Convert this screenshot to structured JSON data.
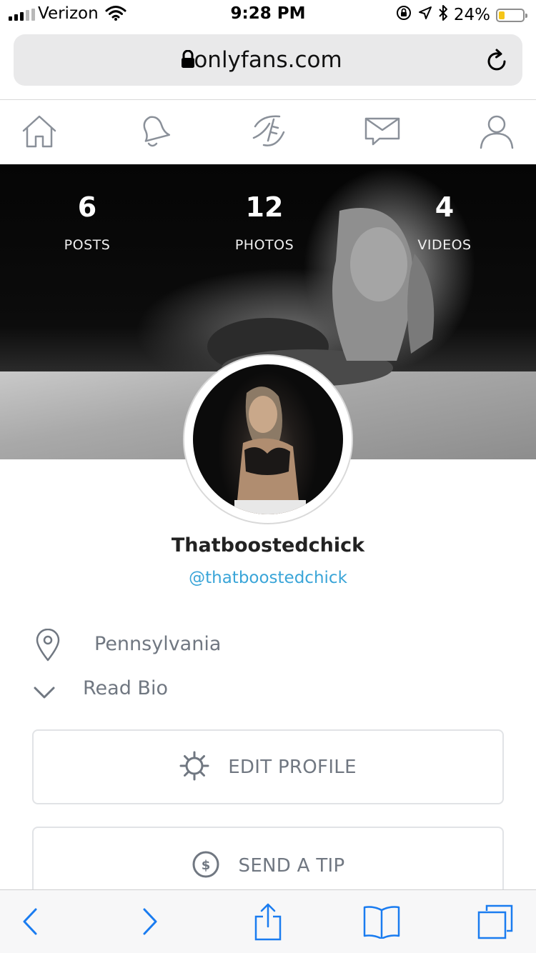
{
  "status_bar": {
    "carrier": "Verizon",
    "time": "9:28 PM",
    "battery_percent_text": "24%",
    "battery_level": 0.24,
    "battery_color": "#f5c518"
  },
  "browser": {
    "url": "onlyfans.com",
    "icons": [
      "lock-icon",
      "reload-icon"
    ]
  },
  "app_nav": {
    "items": [
      {
        "name": "home",
        "icon": "home-icon"
      },
      {
        "name": "notifications",
        "icon": "bell-icon"
      },
      {
        "name": "new-post",
        "icon": "feather-icon"
      },
      {
        "name": "messages",
        "icon": "envelope-icon"
      },
      {
        "name": "profile",
        "icon": "user-icon"
      }
    ]
  },
  "profile": {
    "stats": [
      {
        "count": "6",
        "label": "POSTS"
      },
      {
        "count": "12",
        "label": "PHOTOS"
      },
      {
        "count": "4",
        "label": "VIDEOS"
      }
    ],
    "display_name": "Thatboostedchick",
    "username": "@thatboostedchick",
    "location": "Pennsylvania",
    "bio_toggle": "Read Bio",
    "edit_button": "EDIT PROFILE",
    "tip_button": "SEND A TIP",
    "accent_color": "#3aa5d8",
    "muted_text_color": "#707781"
  },
  "safari_toolbar": {
    "items": [
      "back-icon",
      "forward-icon",
      "share-icon",
      "bookmarks-icon",
      "tabs-icon"
    ],
    "tint_color": "#1a7cf0"
  }
}
